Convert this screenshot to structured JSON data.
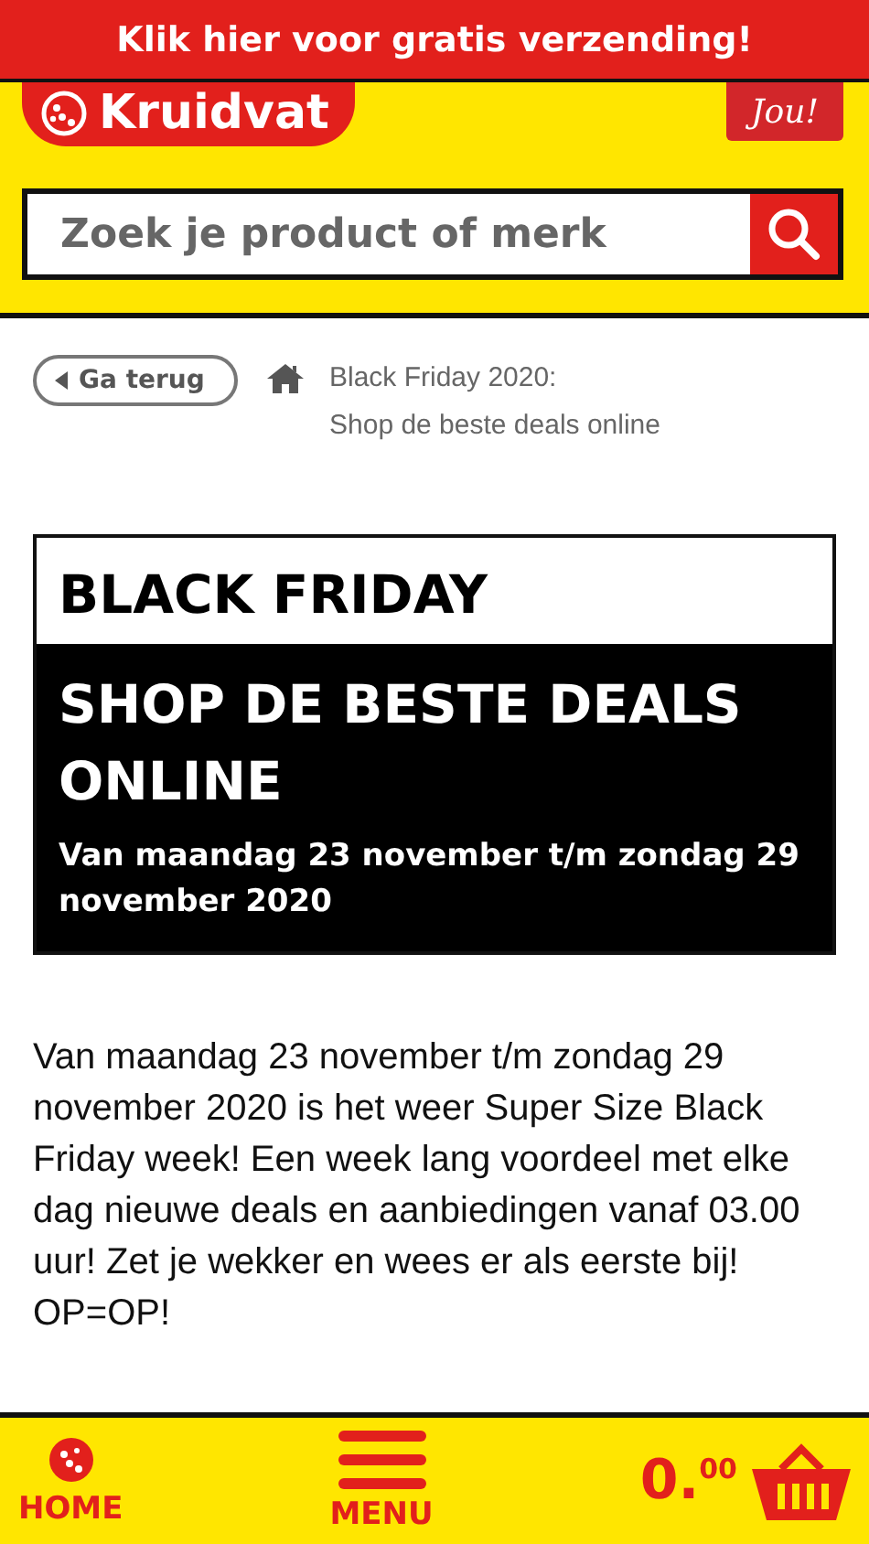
{
  "promo_banner": {
    "text": "Klik hier voor gratis verzending!"
  },
  "header": {
    "logo": "Kruidvat",
    "badge": "Jou!"
  },
  "search": {
    "placeholder": "Zoek je product of merk"
  },
  "breadcrumb": {
    "back": "Ga terug",
    "lines": [
      "Black Friday 2020:",
      "Shop de beste deals online"
    ]
  },
  "hero": {
    "title": "BLACK FRIDAY",
    "subtitle": "SHOP DE BESTE DEALS ONLINE",
    "dates": "Van maandag 23 november t/m zondag 29 november 2020"
  },
  "body_text": "Van maandag 23 november t/m zondag 29 november 2020 is het weer Super Size Black Friday week! Een week lang voordeel met elke dag nieuwe deals en aanbiedingen vanaf 03.00 uur! Zet je wekker en wees er als eerste bij! OP=OP!",
  "bottom_bar": {
    "home": "HOME",
    "menu": "MENU",
    "cart_total": "0.$^{00}$"
  }
}
